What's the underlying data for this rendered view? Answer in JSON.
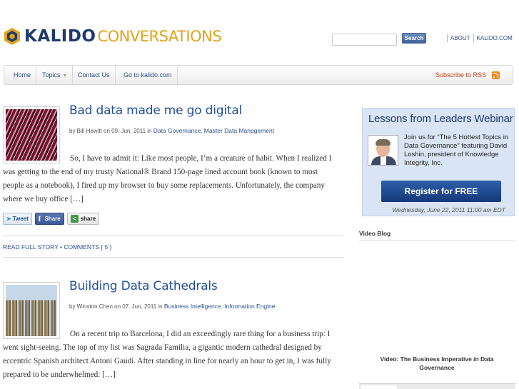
{
  "header": {
    "logo_primary": "KALIDO",
    "logo_secondary": "CONVERSATIONS",
    "search_value": "",
    "search_button": "Search",
    "links": [
      "ABOUT",
      "KALIDO.COM"
    ]
  },
  "nav": {
    "items": [
      "Home",
      "Topics",
      "Contact Us",
      "Go to kalido.com"
    ],
    "rss_label": "Subscribe to RSS"
  },
  "posts": [
    {
      "title": "Bad data made me go digital",
      "meta_prefix": "by Bill Hewitt on 09. Jun, 2011 in",
      "categories": [
        "Data Governance",
        "Master Data Management"
      ],
      "excerpt": "So, I have to admit it: Like most people, I’m a creature of habit. When I realized I was getting to the end of my trusty National® Brand 150-page lined account book (known to most people as a notebook), I fired up my browser to buy some replacements. Unfortunately, the company where we buy office […]",
      "share": {
        "tweet": "Tweet",
        "fb": "Share",
        "share": "share"
      },
      "read_more": "READ FULL STORY",
      "comments": "COMMENTS { 5 }"
    },
    {
      "title": "Building Data Cathedrals",
      "meta_prefix": "by Winston Chen on 07. Jun, 2011 in",
      "categories": [
        "Business Intelligence",
        "Information Engine"
      ],
      "excerpt": "On a recent trip to Barcelona, I did an exceedingly rare thing for a business trip: I went sight-seeing. The top of my list was Sagrada Familia, a gigantic modern cathedral designed by eccentric Spanish architect Antoni Gaudí. After standing in line for nearly an hour to get in, I was fully prepared to be underwhelmed: […]"
    }
  ],
  "sidebar": {
    "webinar": {
      "title": "Lessons from Leaders Webinar",
      "description": "Join us for “The 5 Hottest Topics in Data Governance” featuring David Loshin, president of Knowledge Integrity, Inc.",
      "button": "Register for FREE",
      "date": "Wednesday, June 22, 2011 11:00 am EDT"
    },
    "video": {
      "heading": "Video Blog",
      "caption": "Video: The Business Imperative in Data Governance"
    }
  }
}
